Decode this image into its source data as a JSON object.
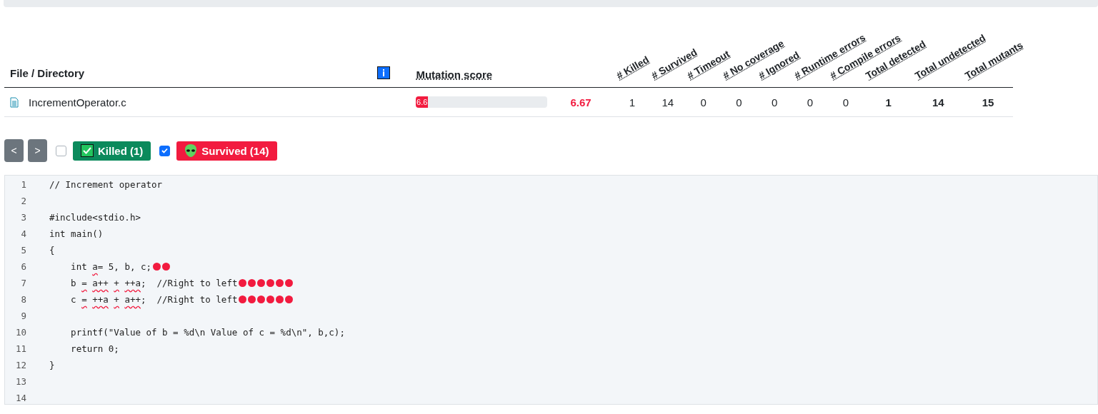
{
  "table": {
    "columns": [
      {
        "label": "File / Directory",
        "kind": "name"
      },
      {
        "label": "Mutation score",
        "kind": "score"
      },
      {
        "kind": "score_value"
      },
      {
        "label": "# Killed",
        "kind": "count"
      },
      {
        "label": "# Survived",
        "kind": "count"
      },
      {
        "label": "# Timeout",
        "kind": "count"
      },
      {
        "label": "# No coverage",
        "kind": "count"
      },
      {
        "label": "# Ignored",
        "kind": "count"
      },
      {
        "label": "# Runtime errors",
        "kind": "count"
      },
      {
        "label": "# Compile errors",
        "kind": "count"
      },
      {
        "label": "Total detected",
        "kind": "total"
      },
      {
        "label": "Total undetected",
        "kind": "total"
      },
      {
        "label": "Total mutants",
        "kind": "total"
      }
    ],
    "rows": [
      {
        "level": 0.0667,
        "cells": [
          "IncrementOperator.c",
          "6.6",
          "6.67",
          "1",
          "14",
          "0",
          "0",
          "0",
          "0",
          "0",
          "1",
          "14",
          "15"
        ]
      }
    ]
  },
  "nav_buttons": [
    "<",
    ">"
  ],
  "filters": [
    {
      "label": "Killed (1)",
      "kind": "killed",
      "checked": false
    },
    {
      "label": "Survived (14)",
      "kind": "survived",
      "checked": true
    }
  ],
  "code": [
    {
      "number": "1",
      "segments": [
        {
          "text": "// Increment operator"
        }
      ]
    },
    {
      "number": "2"
    },
    {
      "number": "3",
      "segments": [
        {
          "text": "#include<stdio.h>"
        }
      ]
    },
    {
      "number": "4",
      "segments": [
        {
          "text": "int main()"
        }
      ]
    },
    {
      "number": "5",
      "segments": [
        {
          "text": "{"
        }
      ]
    },
    {
      "number": "6",
      "segments": [
        {
          "text": "    int "
        },
        {
          "text": "a",
          "mutated": true
        },
        {
          "text": "= 5, b, c;"
        }
      ],
      "mutants": [
        {
          "kind": "survived"
        },
        {
          "kind": "survived"
        }
      ]
    },
    {
      "number": "7",
      "segments": [
        {
          "text": "    b "
        },
        {
          "text": "= ",
          "mutated": true
        },
        {
          "text": "a++ ",
          "mutated": true
        },
        {
          "text": "+ ",
          "mutated": true
        },
        {
          "text": "++a",
          "mutated": true
        },
        {
          "text": ";  //Right to left"
        }
      ],
      "mutants": [
        {
          "kind": "survived"
        },
        {
          "kind": "survived"
        },
        {
          "kind": "survived"
        },
        {
          "kind": "survived"
        },
        {
          "kind": "survived"
        },
        {
          "kind": "survived"
        }
      ]
    },
    {
      "number": "8",
      "segments": [
        {
          "text": "    c "
        },
        {
          "text": "= ",
          "mutated": true
        },
        {
          "text": "++a ",
          "mutated": true
        },
        {
          "text": "+ ",
          "mutated": true
        },
        {
          "text": "a++",
          "mutated": true
        },
        {
          "text": ";  //Right to left"
        }
      ],
      "mutants": [
        {
          "kind": "survived"
        },
        {
          "kind": "survived"
        },
        {
          "kind": "survived"
        },
        {
          "kind": "survived"
        },
        {
          "kind": "survived"
        },
        {
          "kind": "survived"
        }
      ]
    },
    {
      "number": "9"
    },
    {
      "number": "10",
      "segments": [
        {
          "text": "    printf(\"Value of b = %d\\n Value of c = %d\\n\", b,c);"
        }
      ]
    },
    {
      "number": "11",
      "segments": [
        {
          "text": "    return 0;"
        }
      ]
    },
    {
      "number": "12",
      "segments": [
        {
          "text": "}"
        }
      ]
    },
    {
      "number": "13"
    },
    {
      "number": "14"
    }
  ]
}
